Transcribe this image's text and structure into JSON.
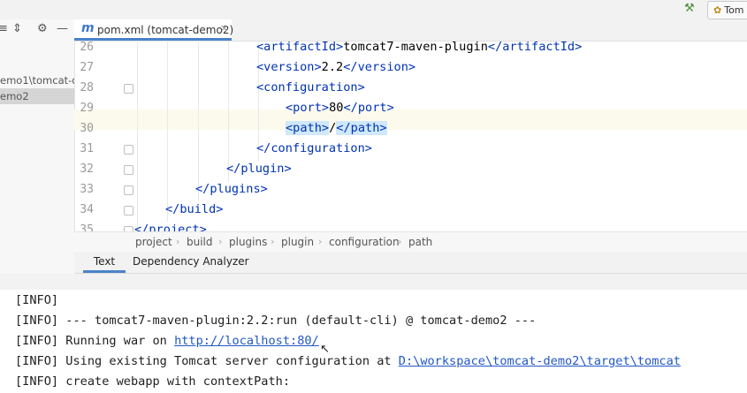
{
  "toolbar": {
    "run_config_label": "Tom"
  },
  "project_panel": {
    "items": [
      {
        "label": "emo1\\tomcat-d"
      },
      {
        "label": "emo2"
      }
    ]
  },
  "editor": {
    "tab_label": "pom.xml (tomcat-demo2)",
    "tab_icon_letter": "m",
    "lines": [
      {
        "num": "26",
        "indent": 140,
        "parts": [
          {
            "t": "<artifactId>",
            "c": "tag"
          },
          {
            "t": "tomcat7-maven-plugin",
            "c": "txt"
          },
          {
            "t": "</artifactId>",
            "c": "tag"
          }
        ]
      },
      {
        "num": "27",
        "indent": 140,
        "parts": [
          {
            "t": "<version>",
            "c": "tag"
          },
          {
            "t": "2.2",
            "c": "txt"
          },
          {
            "t": "</version>",
            "c": "tag"
          }
        ]
      },
      {
        "num": "28",
        "indent": 140,
        "parts": [
          {
            "t": "<configuration>",
            "c": "tag"
          }
        ]
      },
      {
        "num": "29",
        "indent": 173,
        "parts": [
          {
            "t": "<port>",
            "c": "tag"
          },
          {
            "t": "80",
            "c": "txt"
          },
          {
            "t": "</port>",
            "c": "tag"
          }
        ]
      },
      {
        "num": "30",
        "indent": 173,
        "parts": [
          {
            "t": "<path>",
            "c": "tag hl"
          },
          {
            "t": "/",
            "c": "txt"
          },
          {
            "t": "</path>",
            "c": "tag hl"
          }
        ]
      },
      {
        "num": "31",
        "indent": 140,
        "parts": [
          {
            "t": "</configuration>",
            "c": "tag"
          }
        ]
      },
      {
        "num": "32",
        "indent": 106,
        "parts": [
          {
            "t": "</plugin>",
            "c": "tag"
          }
        ]
      },
      {
        "num": "33",
        "indent": 71,
        "parts": [
          {
            "t": "</plugins>",
            "c": "tag"
          }
        ]
      },
      {
        "num": "34",
        "indent": 37,
        "parts": [
          {
            "t": "</build>",
            "c": "tag"
          }
        ]
      },
      {
        "num": "35",
        "indent": 2,
        "parts": [
          {
            "t": "</project>",
            "c": "tag"
          }
        ]
      }
    ],
    "breadcrumb": [
      "project",
      "build",
      "plugins",
      "plugin",
      "configuration",
      "path"
    ],
    "bottom_tabs": {
      "text": "Text",
      "dependency": "Dependency Analyzer"
    }
  },
  "console": {
    "lines": [
      {
        "text": "[INFO]"
      },
      {
        "text": "[INFO] --- tomcat7-maven-plugin:2.2:run (default-cli) @ tomcat-demo2 ---"
      },
      {
        "text": "[INFO] Running war on ",
        "link": "http://localhost:80/"
      },
      {
        "text": "[INFO] Using existing Tomcat server configuration at ",
        "link": "D:\\workspace\\tomcat-demo2\\target\\tomcat"
      },
      {
        "text": "[INFO] create webapp with contextPath:"
      }
    ]
  },
  "colors": {
    "tag": "#0033b3",
    "link": "#2257c6",
    "accent": "#4a83c9",
    "highlight": "#cfe8fc"
  }
}
